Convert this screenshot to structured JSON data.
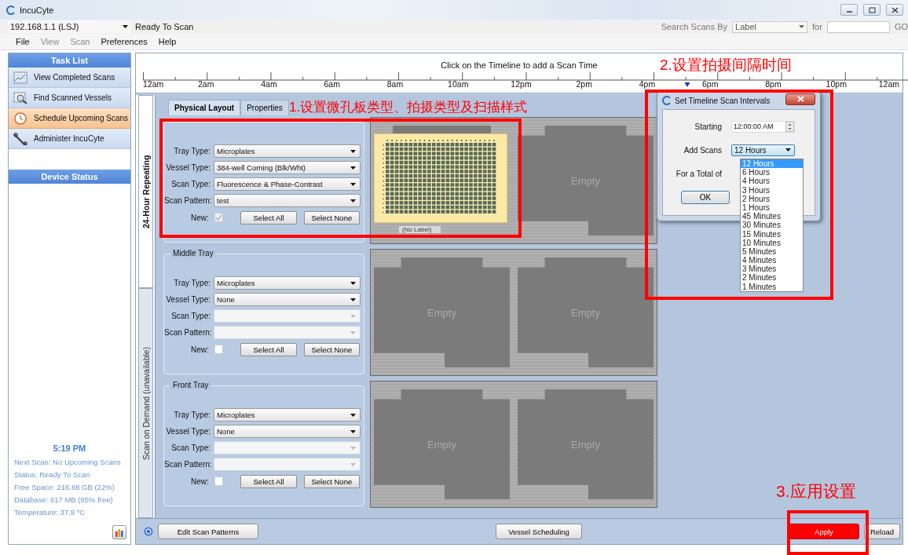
{
  "window": {
    "title": "IncuCyte"
  },
  "connection": {
    "value": "192.168.1.1 (LSJ)",
    "status": "Ready To Scan"
  },
  "search": {
    "label": "Search Scans By",
    "field": "Label",
    "for_label": "for",
    "go": "GO"
  },
  "menu": [
    {
      "label": "File",
      "disabled": false
    },
    {
      "label": "View",
      "disabled": true
    },
    {
      "label": "Scan",
      "disabled": true
    },
    {
      "label": "Preferences",
      "disabled": false
    },
    {
      "label": "Help",
      "disabled": false
    }
  ],
  "sidebar": {
    "task_list_title": "Task List",
    "tasks": [
      {
        "label": "View Completed Scans",
        "kind": "chart",
        "selected": false
      },
      {
        "label": "Find Scanned Vessels",
        "kind": "find",
        "selected": false
      },
      {
        "label": "Schedule Upcoming Scans",
        "kind": "clock",
        "selected": true
      },
      {
        "label": "Administer IncuCyte",
        "kind": "tools",
        "selected": false
      }
    ],
    "device_status_title": "Device Status",
    "time": "5:19 PM",
    "status_lines": [
      "Next Scan: No Upcoming Scans",
      "Status: Ready To Scan",
      "Free Space: 216.88 GB (22%)",
      "Database: 617 MB (85% free)",
      "Temperature: 37.9 ºC"
    ]
  },
  "timeline": {
    "caption": "Click on the Timeline to add a Scan Time",
    "now_marker": {
      "level": 0.72
    },
    "labels": [
      "12am",
      "2am",
      "4am",
      "6am",
      "8am",
      "10am",
      "12pm",
      "2pm",
      "4pm",
      "6pm",
      "8pm",
      "10pm",
      "12am"
    ]
  },
  "schedule_tabs": [
    {
      "label": "24-Hour Repeating",
      "selected": true
    },
    {
      "label": "Scan on Demand (unavailable)",
      "selected": false
    }
  ],
  "layout_tabs": [
    {
      "label": "Physical Layout",
      "selected": true
    },
    {
      "label": "Properties",
      "selected": false
    }
  ],
  "trays": [
    {
      "fields": [
        {
          "label": "Tray Type:",
          "value": "Microplates",
          "disabled": false
        },
        {
          "label": "Vessel Type:",
          "value": "384-well Corning (Blk/Wht)",
          "disabled": false
        },
        {
          "label": "Scan Type:",
          "value": "Fluorescence & Phase-Contrast",
          "disabled": false
        },
        {
          "label": "Scan Pattern:",
          "value": "test",
          "disabled": false
        }
      ],
      "new_label": "New:",
      "new_checked": true,
      "new_disabled": true,
      "select_all": "Select All",
      "select_none": "Select None",
      "slots": [
        {
          "kind": "plate",
          "label": "(No Label)"
        },
        {
          "kind": "empty",
          "label": "Empty"
        }
      ]
    },
    {
      "title": "Middle Tray",
      "fields": [
        {
          "label": "Tray Type:",
          "value": "Microplates",
          "disabled": false
        },
        {
          "label": "Vessel Type:",
          "value": "None",
          "disabled": false
        },
        {
          "label": "Scan Type:",
          "disabled": true
        },
        {
          "label": "Scan Pattern:",
          "disabled": true
        }
      ],
      "new_label": "New:",
      "new_checked": false,
      "new_disabled": false,
      "select_all": "Select All",
      "select_none": "Select None",
      "slots": [
        {
          "kind": "empty",
          "label": "Empty"
        },
        {
          "kind": "empty",
          "label": "Empty"
        }
      ]
    },
    {
      "title": "Front Tray",
      "fields": [
        {
          "label": "Tray Type:",
          "value": "Microplates",
          "disabled": false
        },
        {
          "label": "Vessel Type:",
          "value": "None",
          "disabled": false
        },
        {
          "label": "Scan Type:",
          "disabled": true
        },
        {
          "label": "Scan Pattern:",
          "disabled": true
        }
      ],
      "new_label": "New:",
      "new_checked": false,
      "new_disabled": false,
      "select_all": "Select All",
      "select_none": "Select None",
      "slots": [
        {
          "kind": "empty",
          "label": "Empty"
        },
        {
          "kind": "empty",
          "label": "Empty"
        }
      ]
    }
  ],
  "dialog": {
    "title": "Set Timeline Scan Intervals",
    "starting_label": "Starting",
    "starting_value": "12:00:00 AM",
    "add_label": "Add Scans",
    "add_value": "12 Hours",
    "total_label": "For a Total of",
    "ok": "OK",
    "options": [
      {
        "label": "12 Hours",
        "selected": true
      },
      {
        "label": "6 Hours",
        "selected": false
      },
      {
        "label": "4 Hours",
        "selected": false
      },
      {
        "label": "3 Hours",
        "selected": false
      },
      {
        "label": "2 Hours",
        "selected": false
      },
      {
        "label": "1 Hours",
        "selected": false
      },
      {
        "label": "45 Minutes",
        "selected": false
      },
      {
        "label": "30 Minutes",
        "selected": false
      },
      {
        "label": "15 Minutes",
        "selected": false
      },
      {
        "label": "10 Minutes",
        "selected": false
      },
      {
        "label": "5 Minutes",
        "selected": false
      },
      {
        "label": "4 Minutes",
        "selected": false
      },
      {
        "label": "3 Minutes",
        "selected": false
      },
      {
        "label": "2 Minutes",
        "selected": false
      },
      {
        "label": "1 Minutes",
        "selected": false
      }
    ]
  },
  "bottom_buttons": [
    {
      "label": "Edit Scan Patterns",
      "kind": "normal"
    },
    {
      "label": "Vessel Scheduling",
      "kind": "normal"
    },
    {
      "label": "Apply",
      "kind": "highlighted"
    },
    {
      "label": "Reload",
      "kind": "normal"
    }
  ],
  "annotations": [
    {
      "text": "1.设置微孔板类型、拍摄类型及扫描样式"
    },
    {
      "text": "2.设置拍摄间隔时间"
    },
    {
      "text": "3.应用设置"
    }
  ]
}
